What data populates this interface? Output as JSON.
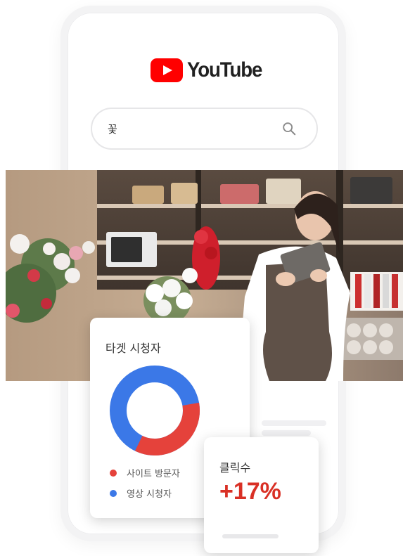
{
  "app": {
    "brand_name": "YouTube",
    "brand_color": "#FF0000"
  },
  "search": {
    "value": "꽃",
    "icon": "search-icon"
  },
  "hero_image": {
    "description_icon": "florist-photo"
  },
  "target_audience_card": {
    "title": "타겟 시청자",
    "legend": [
      {
        "label": "사이트 방문자",
        "color": "#E5423B"
      },
      {
        "label": "영상 시청자",
        "color": "#3B78E7"
      }
    ],
    "donut_share": {
      "site_visitors": 0.35,
      "video_viewers": 0.65
    }
  },
  "clicks_card": {
    "title": "클릭수",
    "value": "+17%",
    "value_color": "#D93025"
  }
}
